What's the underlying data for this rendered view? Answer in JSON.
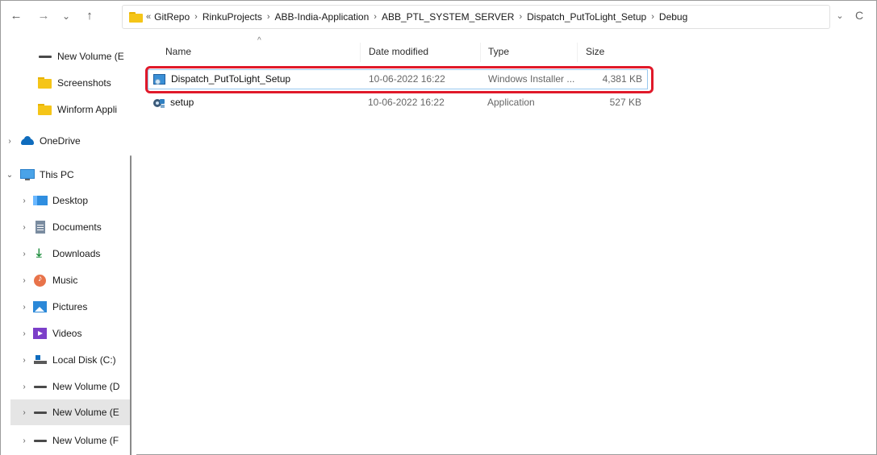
{
  "nav": {
    "back_icon": "arrow-left-icon",
    "forward_icon": "arrow-right-icon",
    "recent_icon": "chevron-down-icon",
    "up_icon": "arrow-up-icon",
    "back_glyph": "←",
    "forward_glyph": "→",
    "recent_glyph": "⌄",
    "up_glyph": "↑"
  },
  "address": {
    "overflow": "«",
    "separator": "›",
    "crumbs": [
      "GitRepo",
      "RinkuProjects",
      "ABB-India-Application",
      "ABB_PTL_SYSTEM_SERVER",
      "Dispatch_PutToLight_Setup",
      "Debug"
    ],
    "dropdown_glyph": "⌄",
    "refresh_glyph": "C"
  },
  "sidebar": {
    "items": [
      {
        "label": "New Volume (E",
        "icon": "drive-icon",
        "chevron": ""
      },
      {
        "label": "Screenshots",
        "icon": "folder-icon",
        "chevron": ""
      },
      {
        "label": "Winform Appli",
        "icon": "folder-icon",
        "chevron": ""
      },
      {
        "label": "OneDrive",
        "icon": "cloud-icon",
        "chevron": "›"
      },
      {
        "label": "This PC",
        "icon": "monitor-icon",
        "chevron": "⌄"
      },
      {
        "label": "Desktop",
        "icon": "desktop-icon",
        "chevron": "›"
      },
      {
        "label": "Documents",
        "icon": "document-icon",
        "chevron": "›"
      },
      {
        "label": "Downloads",
        "icon": "download-icon",
        "chevron": "›"
      },
      {
        "label": "Music",
        "icon": "music-icon",
        "chevron": "›"
      },
      {
        "label": "Pictures",
        "icon": "pictures-icon",
        "chevron": "›"
      },
      {
        "label": "Videos",
        "icon": "videos-icon",
        "chevron": "›"
      },
      {
        "label": "Local Disk (C:)",
        "icon": "local-disk-icon",
        "chevron": "›"
      },
      {
        "label": "New Volume (D",
        "icon": "drive-icon",
        "chevron": "›"
      },
      {
        "label": "New Volume (E",
        "icon": "drive-icon",
        "chevron": "›",
        "selected": true
      },
      {
        "label": "New Volume (F",
        "icon": "drive-icon",
        "chevron": "›"
      }
    ]
  },
  "columns": {
    "name": "Name",
    "date": "Date modified",
    "type": "Type",
    "size": "Size",
    "sort_glyph": "^"
  },
  "files": [
    {
      "name": "Dispatch_PutToLight_Setup",
      "date": "10-06-2022 16:22",
      "type": "Windows Installer ...",
      "size": "4,381 KB",
      "icon": "installer-icon",
      "highlighted": true
    },
    {
      "name": "setup",
      "date": "10-06-2022 16:22",
      "type": "Application",
      "size": "527 KB",
      "icon": "setup-app-icon"
    }
  ],
  "colors": {
    "highlight": "#e0192a",
    "selection": "#99c9ef"
  }
}
